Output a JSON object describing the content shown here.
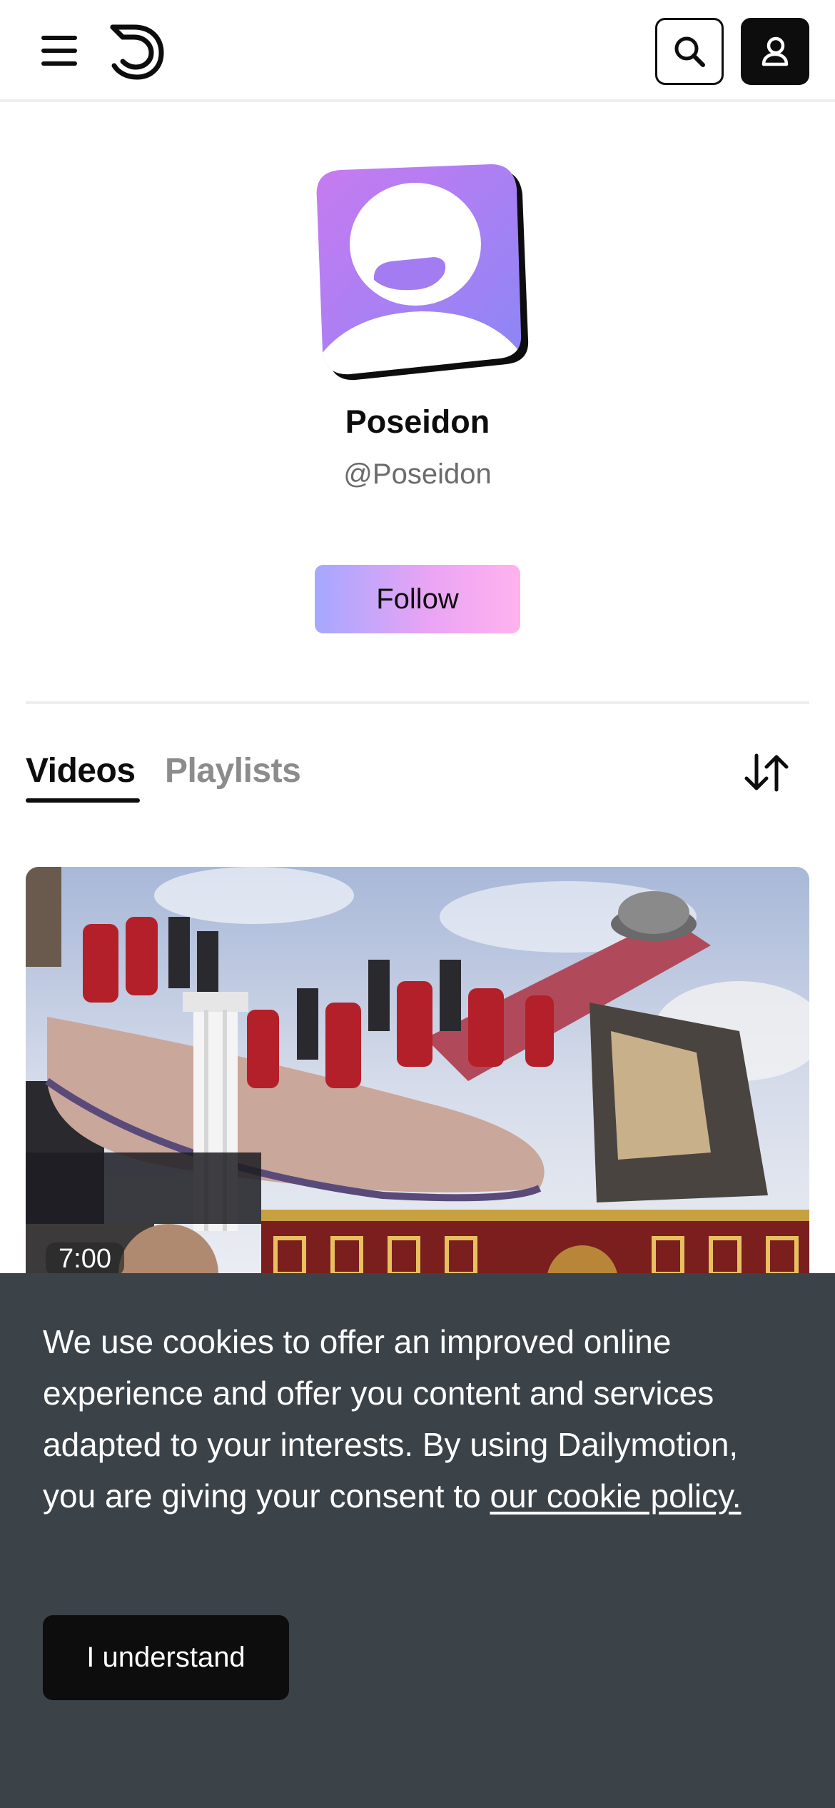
{
  "header": {
    "menu_icon": "hamburger-menu-icon",
    "logo_icon": "dailymotion-logo-icon",
    "search_icon": "search-icon",
    "account_icon": "account-icon"
  },
  "profile": {
    "name": "Poseidon",
    "handle": "@Poseidon",
    "follow_label": "Follow",
    "avatar_colors": [
      "#c87af0",
      "#8a86f6"
    ]
  },
  "tabs": [
    {
      "label": "Videos",
      "active": true
    },
    {
      "label": "Playlists",
      "active": false
    }
  ],
  "sort_icon": "sort-arrows-icon",
  "videos": [
    {
      "duration": "7:00",
      "thumbnail": "amusement-park-ride-thumbnail"
    }
  ],
  "cookie_banner": {
    "text": "We use cookies to offer an improved online experience and offer you content and services adapted to your interests. By using Dailymotion, you are giving your consent to ",
    "link_text": "our cookie policy.",
    "button_label": "I understand",
    "background": "#3b4248"
  }
}
